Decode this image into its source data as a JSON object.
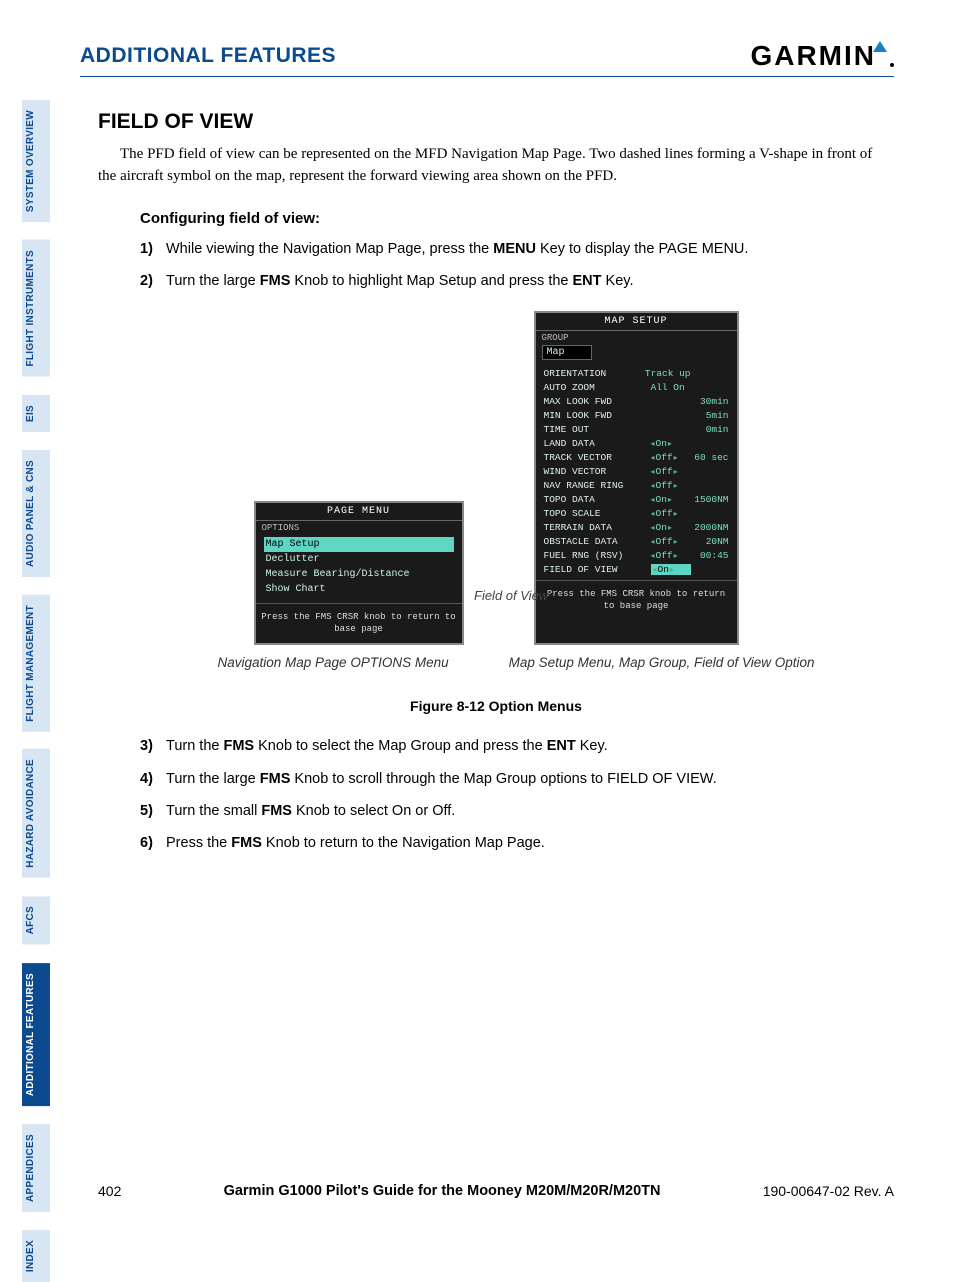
{
  "header": {
    "title": "ADDITIONAL FEATURES",
    "logo": "GARMIN"
  },
  "tabs": [
    "SYSTEM OVERVIEW",
    "FLIGHT INSTRUMENTS",
    "EIS",
    "AUDIO PANEL & CNS",
    "FLIGHT MANAGEMENT",
    "HAZARD AVOIDANCE",
    "AFCS",
    "ADDITIONAL FEATURES",
    "APPENDICES",
    "INDEX"
  ],
  "section": {
    "title": "FIELD OF VIEW",
    "body": "The PFD field of view can be represented on the MFD Navigation Map Page.  Two dashed lines forming a V-shape in front of the aircraft symbol on the map, represent the forward viewing area shown on the PFD.",
    "proc_title": "Configuring field of view:",
    "steps_a": [
      {
        "n": "1)",
        "pre": "While viewing the Navigation Map Page, press the ",
        "b": "MENU",
        "post": " Key to display the PAGE MENU."
      },
      {
        "n": "2)",
        "pre": "Turn the large ",
        "b": "FMS",
        "post": " Knob to highlight Map Setup and press the ",
        "b2": "ENT",
        "post2": " Key."
      }
    ],
    "steps_b": [
      {
        "n": "3)",
        "pre": "Turn the ",
        "b": "FMS",
        "post": " Knob to select the Map Group and press the ",
        "b2": "ENT",
        "post2": " Key."
      },
      {
        "n": "4)",
        "pre": "Turn the large ",
        "b": "FMS",
        "post": " Knob to scroll through the Map Group options to FIELD OF VIEW."
      },
      {
        "n": "5)",
        "pre": "Turn the small ",
        "b": "FMS",
        "post": " Knob to select On or Off."
      },
      {
        "n": "6)",
        "pre": "Press the ",
        "b": "FMS",
        "post": " Knob to return to the Navigation Map Page."
      }
    ]
  },
  "page_menu": {
    "title": "PAGE MENU",
    "group": "OPTIONS",
    "items": [
      "Map Setup",
      "Declutter",
      "Measure Bearing/Distance",
      "Show Chart"
    ],
    "footer": "Press the FMS CRSR knob to return to base page"
  },
  "map_setup": {
    "title": "MAP SETUP",
    "group_label": "GROUP",
    "group_value": "Map",
    "rows": [
      {
        "label": "ORIENTATION",
        "v1": "Track up",
        "v2": ""
      },
      {
        "label": "AUTO ZOOM",
        "v1": "All On",
        "v2": ""
      },
      {
        "label": "  MAX LOOK FWD",
        "v1": "",
        "v2": "30min"
      },
      {
        "label": "  MIN LOOK FWD",
        "v1": "",
        "v2": "5min"
      },
      {
        "label": "  TIME OUT",
        "v1": "",
        "v2": "0min"
      },
      {
        "label": "LAND DATA",
        "v1": "On",
        "v2": "",
        "arrows": true
      },
      {
        "label": "TRACK VECTOR",
        "v1": "Off",
        "v2": "60 sec",
        "arrows": true
      },
      {
        "label": "WIND VECTOR",
        "v1": "Off",
        "v2": "",
        "arrows": true
      },
      {
        "label": "NAV RANGE RING",
        "v1": "Off",
        "v2": "",
        "arrows": true
      },
      {
        "label": "TOPO DATA",
        "v1": "On",
        "v2": "1500NM",
        "arrows": true
      },
      {
        "label": "TOPO SCALE",
        "v1": "Off",
        "v2": "",
        "arrows": true
      },
      {
        "label": "TERRAIN DATA",
        "v1": "On",
        "v2": "2000NM",
        "arrows": true
      },
      {
        "label": "OBSTACLE DATA",
        "v1": "Off",
        "v2": "20NM",
        "arrows": true
      },
      {
        "label": "FUEL RNG (RSV)",
        "v1": "Off",
        "v2": "00:45",
        "arrows": true
      },
      {
        "label": "FIELD OF VIEW",
        "v1": "On",
        "v2": "",
        "arrows": true,
        "hl": true
      }
    ],
    "footer": "Press the FMS CRSR knob to return to base page"
  },
  "fov_label": "Field of View",
  "captions": {
    "left": "Navigation Map Page OPTIONS Menu",
    "right": "Map Setup Menu, Map Group, Field of View Option"
  },
  "figure_title": "Figure 8-12  Option Menus",
  "footer": {
    "page": "402",
    "center": "Garmin G1000 Pilot's Guide for the Mooney M20M/M20R/M20TN",
    "right": "190-00647-02   Rev. A"
  }
}
